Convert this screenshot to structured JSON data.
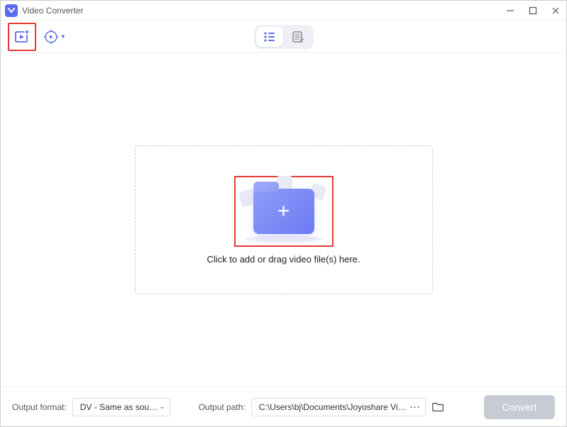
{
  "window": {
    "title": "Video Converter"
  },
  "dropzone": {
    "hint": "Click to add or drag video file(s) here."
  },
  "bottom": {
    "format_label": "Output format:",
    "format_value": "DV - Same as sou…",
    "path_label": "Output path:",
    "path_value": "C:\\Users\\bj\\Documents\\Joyoshare VidiK",
    "convert_label": "Convert"
  }
}
